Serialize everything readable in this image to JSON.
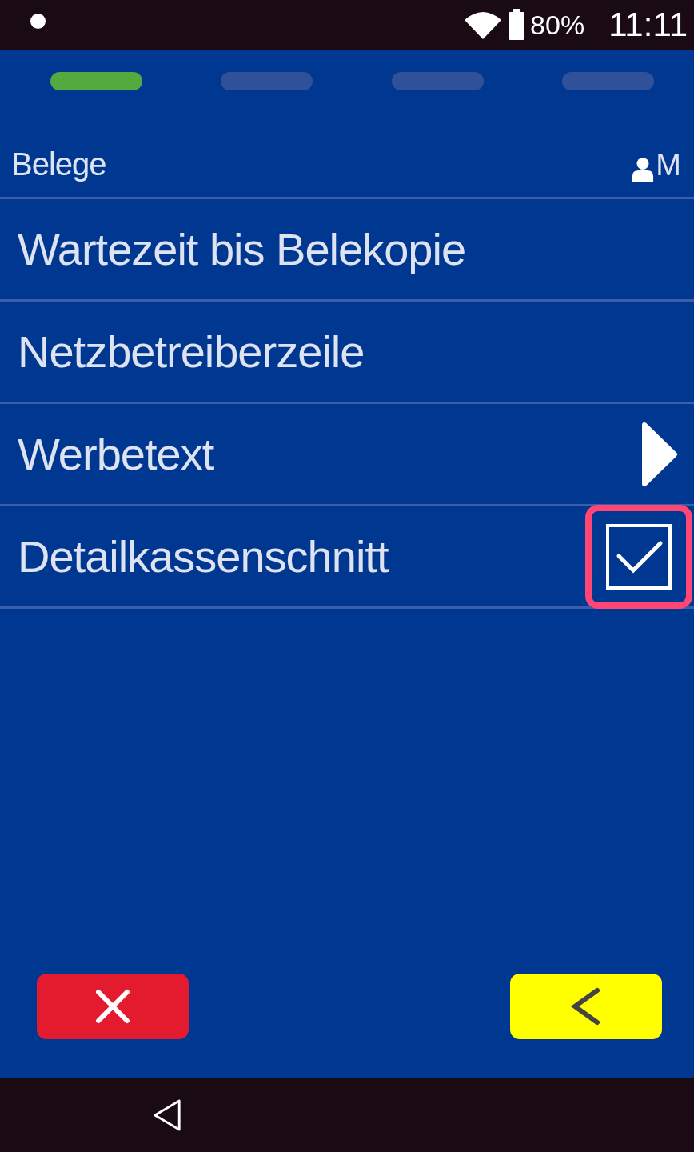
{
  "status_bar": {
    "battery": "80%",
    "time": "11:11"
  },
  "steps": [
    {
      "selected": true
    },
    {
      "selected": false
    },
    {
      "selected": false
    },
    {
      "selected": false
    }
  ],
  "header": {
    "title": "Belege",
    "user": "M"
  },
  "items": [
    {
      "label": "Wartezeit bis Belekopie",
      "kind": "plain"
    },
    {
      "label": "Netzbetreiberzeile",
      "kind": "plain"
    },
    {
      "label": "Werbetext",
      "kind": "submenu"
    },
    {
      "label": "Detailkassenschnitt",
      "kind": "checkbox",
      "checked": true,
      "highlighted": true
    }
  ]
}
